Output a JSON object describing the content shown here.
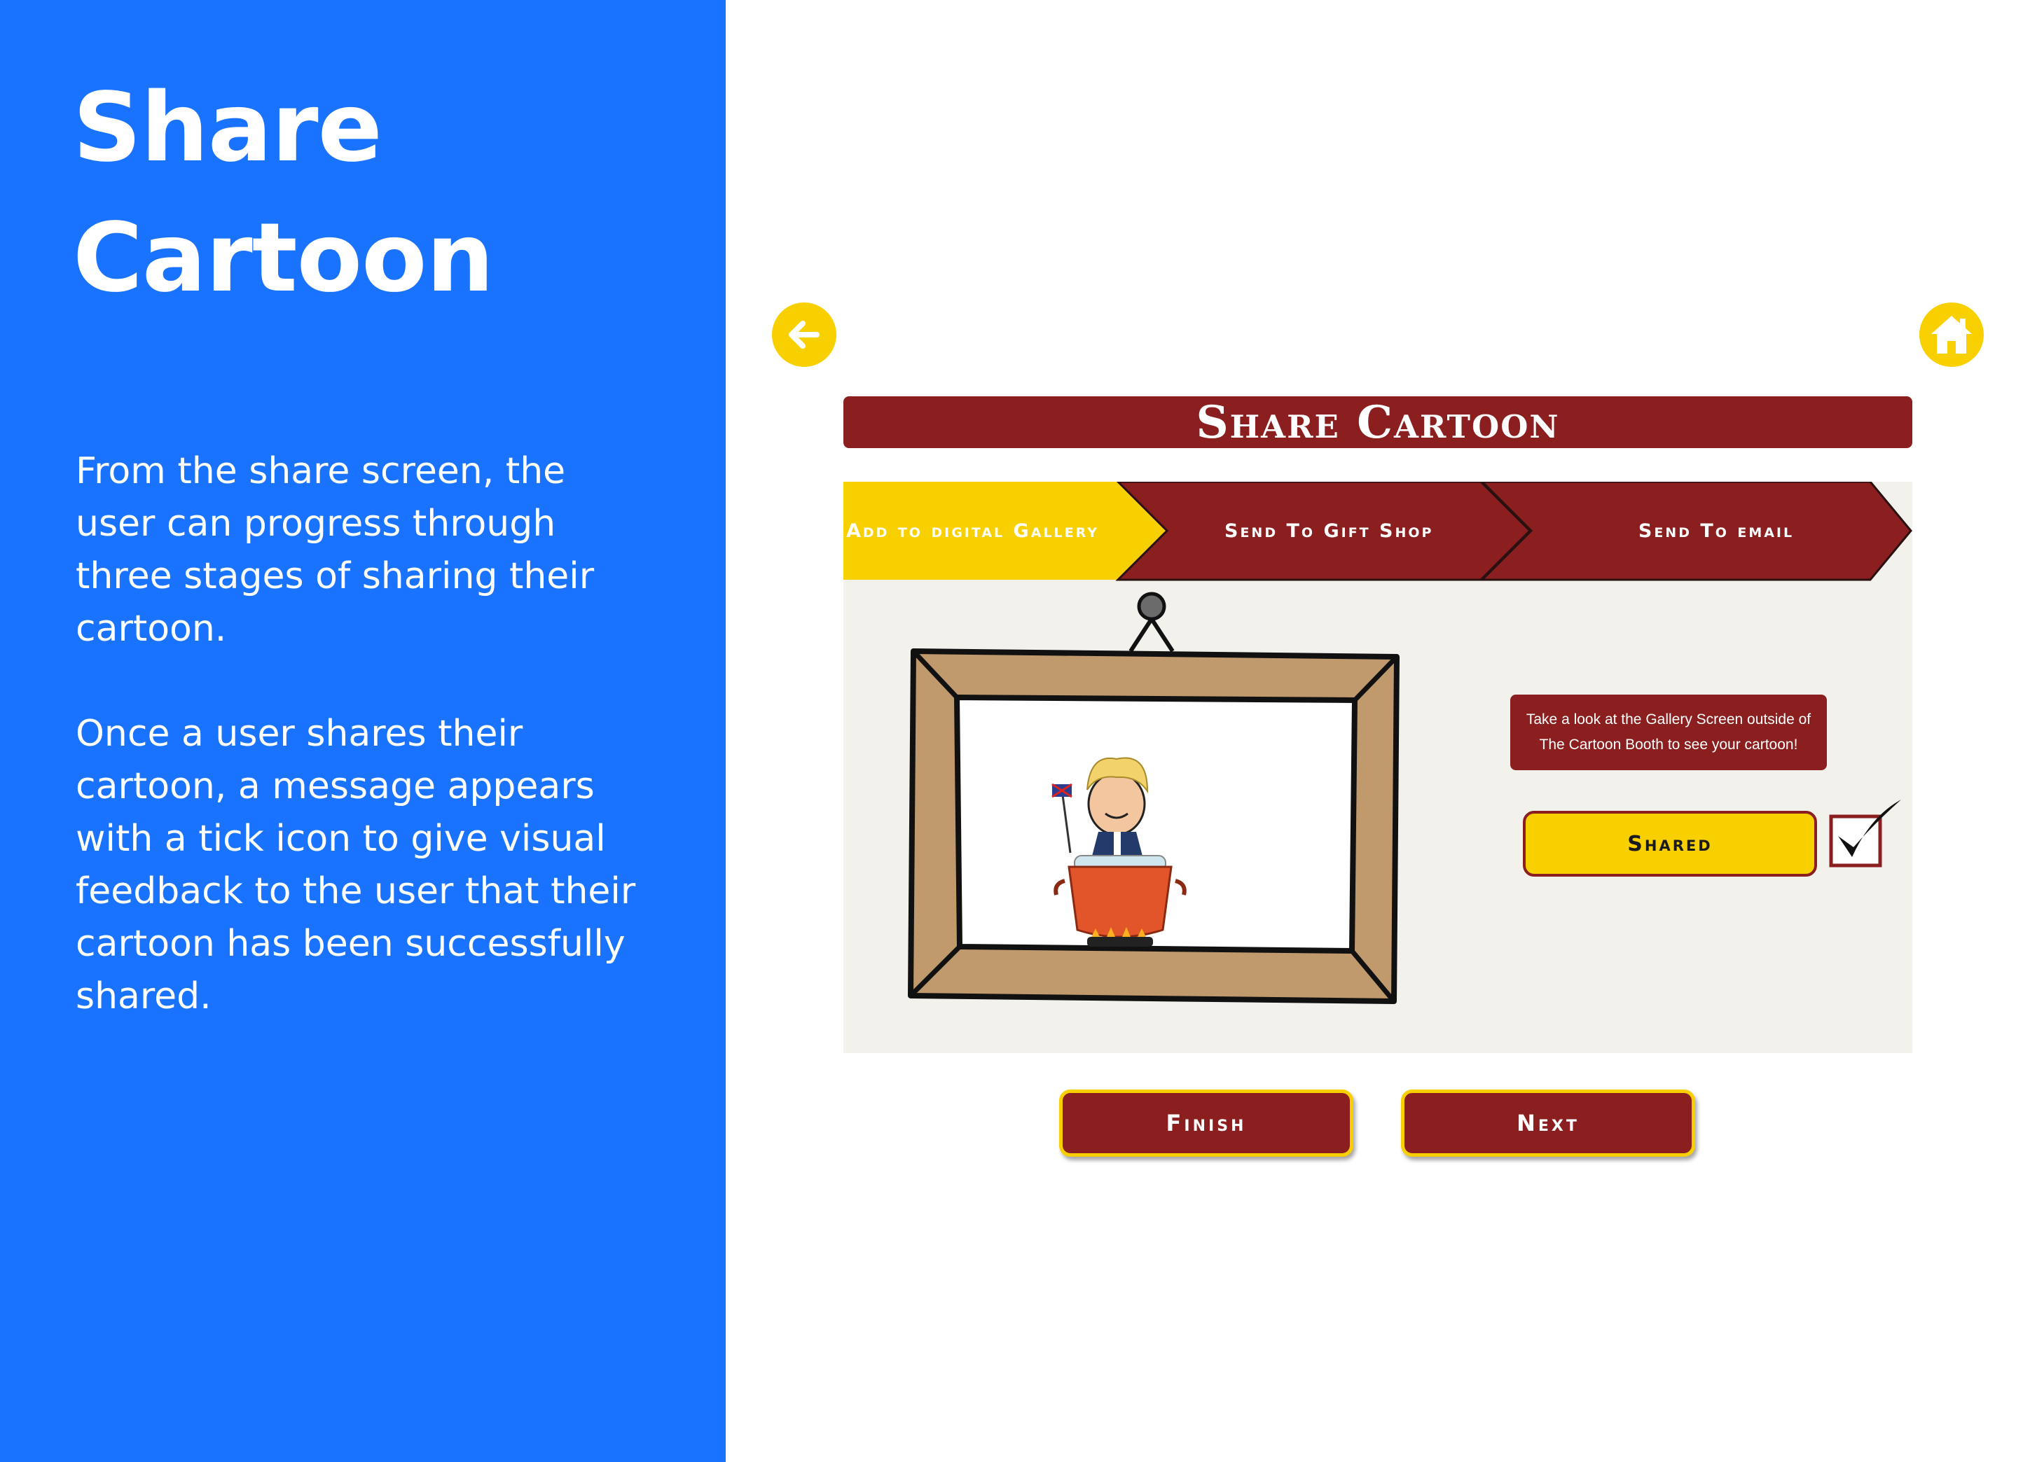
{
  "left_panel": {
    "title_line1": "Share",
    "title_line2": "Cartoon",
    "paragraph1": "From the share screen, the user can progress through three stages of sharing their cartoon.",
    "paragraph2": "Once a user shares their cartoon, a message appears with a tick icon to give visual feedback to the user that their cartoon has been successfully shared.",
    "background_color": "#1a73ff"
  },
  "app": {
    "back_icon": "arrow-left-icon",
    "home_icon": "home-icon",
    "title": "Share Cartoon",
    "steps": [
      {
        "label": "Add to digital Gallery",
        "active": true
      },
      {
        "label": "Send To Gift Shop",
        "active": false
      },
      {
        "label": "Send To email",
        "active": false
      }
    ],
    "message": "Take a look at the Gallery Screen outside of The Cartoon Booth to see your cartoon!",
    "shared_label": "Shared",
    "shared_checked": true,
    "finish_label": "Finish",
    "next_label": "Next",
    "colors": {
      "accent_red": "#8b1f1f",
      "accent_yellow": "#f8d000",
      "frame_brown": "#c09a6c"
    }
  }
}
